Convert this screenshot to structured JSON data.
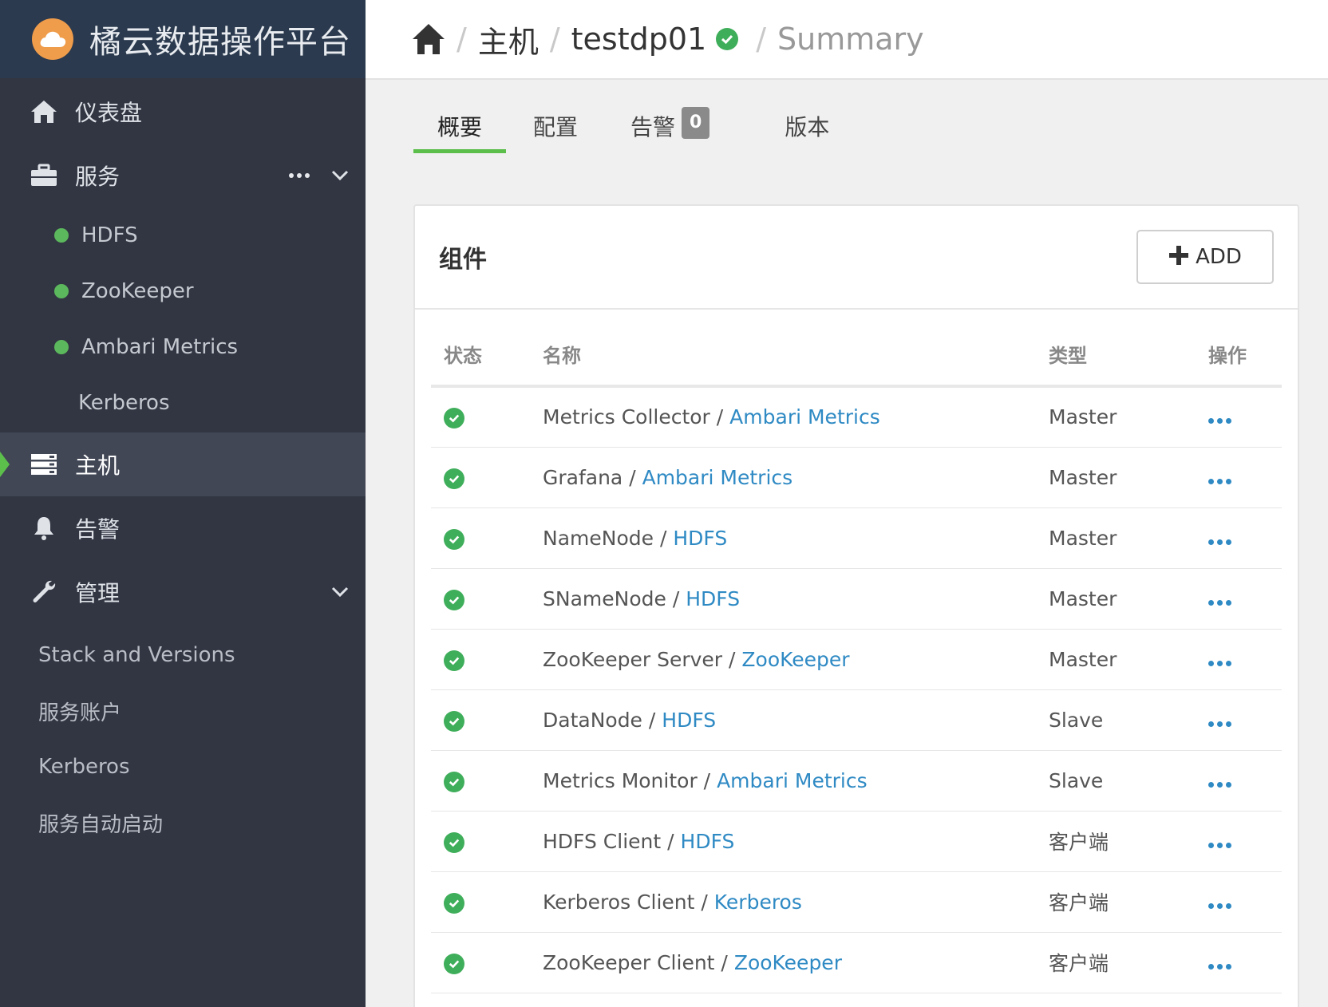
{
  "brand": {
    "title": "橘云数据操作平台"
  },
  "sidebar": {
    "dashboard": "仪表盘",
    "services": {
      "label": "服务",
      "items": [
        {
          "label": "HDFS",
          "status": "green"
        },
        {
          "label": "ZooKeeper",
          "status": "green"
        },
        {
          "label": "Ambari Metrics",
          "status": "green"
        },
        {
          "label": "Kerberos",
          "status": "none"
        }
      ]
    },
    "hosts": "主机",
    "alerts": "告警",
    "admin": {
      "label": "管理",
      "items": [
        "Stack and Versions",
        "服务账户",
        "Kerberos",
        "服务自动启动"
      ]
    }
  },
  "breadcrumb": {
    "hosts": "主机",
    "host": "testdp01",
    "page": "Summary",
    "separator": "/"
  },
  "tabs": {
    "summary": "概要",
    "configs": "配置",
    "alerts": "告警",
    "alerts_count": "0",
    "versions": "版本"
  },
  "panel": {
    "title": "组件",
    "add_label": "ADD",
    "columns": {
      "status": "状态",
      "name": "名称",
      "type": "类型",
      "actions": "操作"
    },
    "rows": [
      {
        "component": "Metrics Collector",
        "service": "Ambari Metrics",
        "type": "Master"
      },
      {
        "component": "Grafana",
        "service": "Ambari Metrics",
        "type": "Master"
      },
      {
        "component": "NameNode",
        "service": "HDFS",
        "type": "Master"
      },
      {
        "component": "SNameNode",
        "service": "HDFS",
        "type": "Master"
      },
      {
        "component": "ZooKeeper Server",
        "service": "ZooKeeper",
        "type": "Master"
      },
      {
        "component": "DataNode",
        "service": "HDFS",
        "type": "Slave"
      },
      {
        "component": "Metrics Monitor",
        "service": "Ambari Metrics",
        "type": "Slave"
      },
      {
        "component": "HDFS Client",
        "service": "HDFS",
        "type": "客户端"
      },
      {
        "component": "Kerberos Client",
        "service": "Kerberos",
        "type": "客户端"
      },
      {
        "component": "ZooKeeper Client",
        "service": "ZooKeeper",
        "type": "客户端"
      }
    ]
  },
  "colors": {
    "accent": "#5cbf4b",
    "link": "#2f8ac4",
    "ok": "#3fae5b",
    "sidebar": "#323643"
  }
}
